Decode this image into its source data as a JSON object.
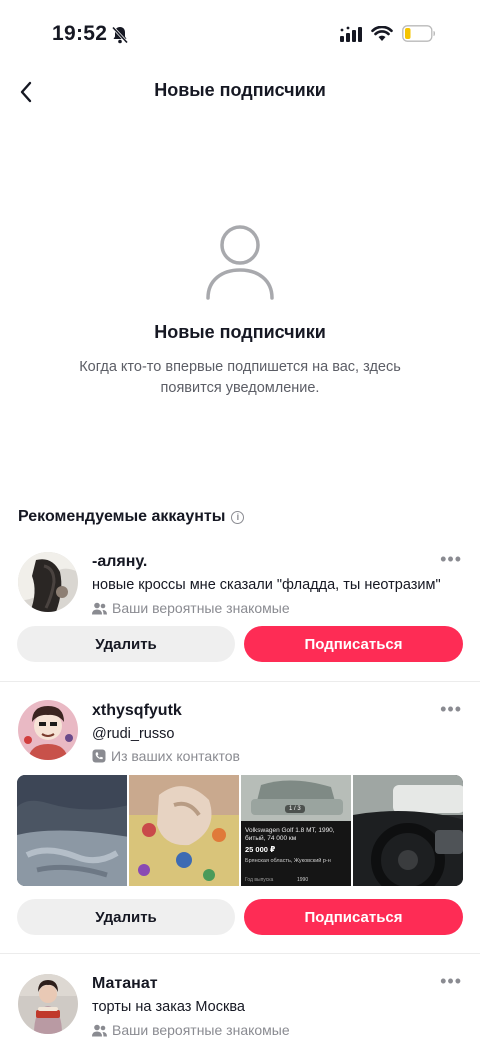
{
  "status_bar": {
    "time": "19:52"
  },
  "nav": {
    "title": "Новые подписчики"
  },
  "empty_state": {
    "title": "Новые подписчики",
    "description": "Когда кто-то впервые подпишется на вас, здесь появится уведомление."
  },
  "recommended": {
    "title": "Рекомендуемые аккаунты",
    "remove_label": "Удалить",
    "follow_label": "Подписаться",
    "accounts": [
      {
        "name": "-аляну.",
        "line": "новые кроссы мне сказали \"фладда, ты неотразим\"",
        "meta": "Ваши вероятные знакомые",
        "meta_icon": "people-icon"
      },
      {
        "name": "xthysqfyutk",
        "line": "@rudi_russo",
        "meta": "Из ваших контактов",
        "meta_icon": "phone-icon"
      },
      {
        "name": "Матанат",
        "line": "торты на заказ Москва",
        "meta": "Ваши вероятные знакомые",
        "meta_icon": "people-icon"
      }
    ],
    "listing": {
      "title": "Volkswagen Golf 1.8 MT, 1990, битый, 74 000 км",
      "price": "25 000 ₽",
      "region": "Брянская область, Жуковский р-н",
      "year_label": "Год выпуска",
      "year": "1990",
      "counter": "1 / 3"
    }
  },
  "colors": {
    "accent": "#fe2c55",
    "secondary_bg": "#efefef",
    "muted_text": "#8a8b91"
  }
}
